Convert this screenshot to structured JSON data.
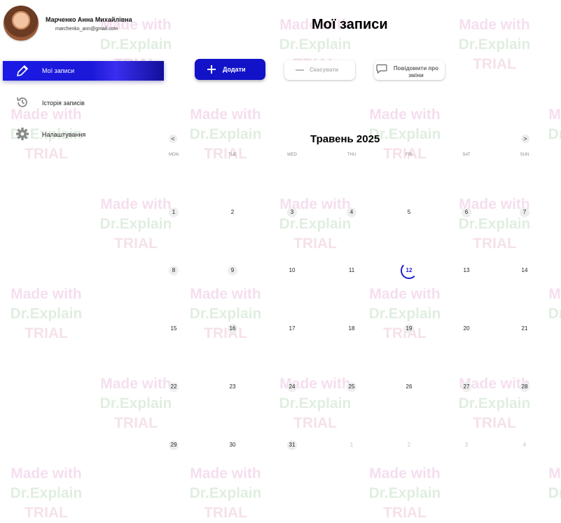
{
  "profile": {
    "name": "Марченко Анна Михайлівна",
    "email": "marchenko_ann@gmail.com"
  },
  "sidebar": {
    "items": [
      {
        "label": "Мої записи",
        "icon": "pencil-icon",
        "active": true
      },
      {
        "label": "Історія записів",
        "icon": "history-icon",
        "active": false
      },
      {
        "label": "Налаштування",
        "icon": "gear-icon",
        "active": false
      }
    ]
  },
  "header": {
    "title": "Мої записи",
    "add_label": "Додати",
    "cancel_label": "Скасувати",
    "notify_label": "Повідомити про зміни"
  },
  "calendar": {
    "month_title": "Травень 2025",
    "prev": "<",
    "next": ">",
    "weekdays": [
      "MON",
      "TUE",
      "WED",
      "THU",
      "FRI",
      "SAT",
      "SUN"
    ],
    "days": [
      {
        "label": "1",
        "state": "bg"
      },
      {
        "label": "2",
        "state": ""
      },
      {
        "label": "3",
        "state": "bg"
      },
      {
        "label": "4",
        "state": "bg"
      },
      {
        "label": "5",
        "state": ""
      },
      {
        "label": "6",
        "state": "bg"
      },
      {
        "label": "7",
        "state": "bg"
      },
      {
        "label": "8",
        "state": "bg"
      },
      {
        "label": "9",
        "state": "bg"
      },
      {
        "label": "10",
        "state": ""
      },
      {
        "label": "11",
        "state": ""
      },
      {
        "label": "12",
        "state": "today"
      },
      {
        "label": "13",
        "state": ""
      },
      {
        "label": "14",
        "state": ""
      },
      {
        "label": "15",
        "state": ""
      },
      {
        "label": "16",
        "state": "bg"
      },
      {
        "label": "17",
        "state": ""
      },
      {
        "label": "18",
        "state": ""
      },
      {
        "label": "19",
        "state": "bg"
      },
      {
        "label": "20",
        "state": ""
      },
      {
        "label": "21",
        "state": ""
      },
      {
        "label": "22",
        "state": "bg"
      },
      {
        "label": "23",
        "state": ""
      },
      {
        "label": "24",
        "state": "bg"
      },
      {
        "label": "25",
        "state": "bg"
      },
      {
        "label": "26",
        "state": ""
      },
      {
        "label": "27",
        "state": "bg"
      },
      {
        "label": "28",
        "state": "bg"
      },
      {
        "label": "29",
        "state": "bg"
      },
      {
        "label": "30",
        "state": ""
      },
      {
        "label": "31",
        "state": "bg"
      },
      {
        "label": "1",
        "state": "muted"
      },
      {
        "label": "2",
        "state": "muted"
      },
      {
        "label": "3",
        "state": "muted"
      },
      {
        "label": "4",
        "state": "muted"
      }
    ]
  },
  "watermark": {
    "line1": "Made with",
    "line2": "Dr.Explain",
    "line3": "TRIAL"
  },
  "colors": {
    "accent": "#1212c8",
    "today": "#1a1ad0"
  }
}
